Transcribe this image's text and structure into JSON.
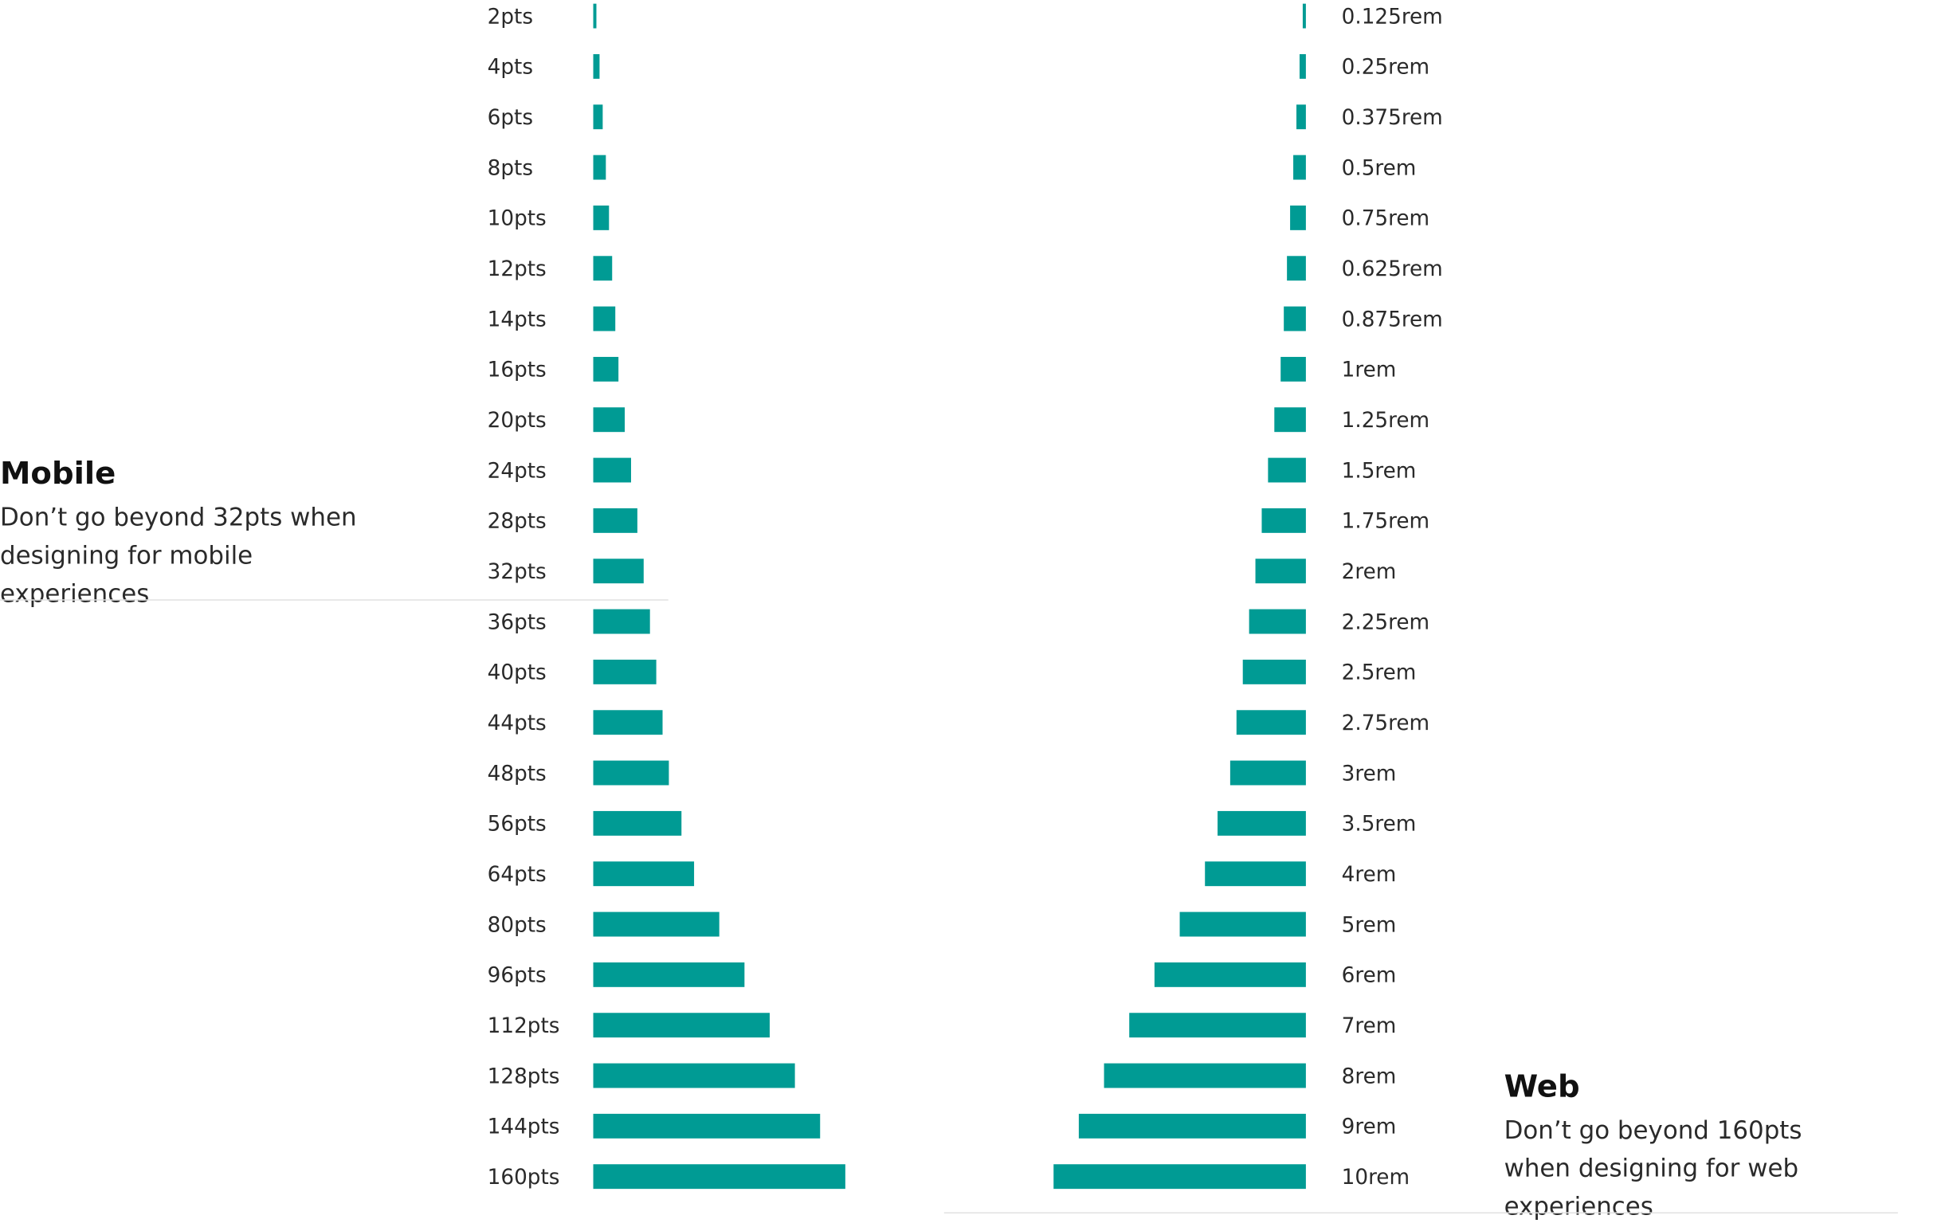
{
  "colors": {
    "bar": "#009b94",
    "text": "#2a2a2a",
    "title": "#111111",
    "rule": "#e2e2e2"
  },
  "notes": {
    "mobile": {
      "title": "Mobile",
      "body": "Don’t go beyond 32pts when designing for mobile experiences"
    },
    "web": {
      "title": "Web",
      "body": "Don’t go beyond 160pts when designing for web experiences"
    }
  },
  "chart_data": [
    {
      "type": "bar",
      "orientation": "horizontal",
      "bar_direction": "rightward",
      "unit": "pts",
      "categories": [
        "2pts",
        "4pts",
        "6pts",
        "8pts",
        "10pts",
        "12pts",
        "14pts",
        "16pts",
        "20pts",
        "24pts",
        "28pts",
        "32pts",
        "36pts",
        "40pts",
        "44pts",
        "48pts",
        "56pts",
        "64pts",
        "80pts",
        "96pts",
        "112pts",
        "128pts",
        "144pts",
        "160pts"
      ],
      "values": [
        2,
        4,
        6,
        8,
        10,
        12,
        14,
        16,
        20,
        24,
        28,
        32,
        36,
        40,
        44,
        48,
        56,
        64,
        80,
        96,
        112,
        128,
        144,
        160
      ],
      "title": "",
      "xlabel": "",
      "ylabel": "",
      "grid": false,
      "legend": "none"
    },
    {
      "type": "bar",
      "orientation": "horizontal",
      "bar_direction": "leftward",
      "unit": "rem",
      "categories": [
        "0.125rem",
        "0.25rem",
        "0.375rem",
        "0.5rem",
        "0.75rem",
        "0.625rem",
        "0.875rem",
        "1rem",
        "1.25rem",
        "1.5rem",
        "1.75rem",
        "2rem",
        "2.25rem",
        "2.5rem",
        "2.75rem",
        "3rem",
        "3.5rem",
        "4rem",
        "5rem",
        "6rem",
        "7rem",
        "8rem",
        "9rem",
        "10rem"
      ],
      "values": [
        0.125,
        0.25,
        0.375,
        0.5,
        0.625,
        0.75,
        0.875,
        1,
        1.25,
        1.5,
        1.75,
        2,
        2.25,
        2.5,
        2.75,
        3,
        3.5,
        4,
        5,
        6,
        7,
        8,
        9,
        10
      ],
      "title": "",
      "xlabel": "",
      "ylabel": "",
      "grid": false,
      "legend": "none"
    }
  ]
}
